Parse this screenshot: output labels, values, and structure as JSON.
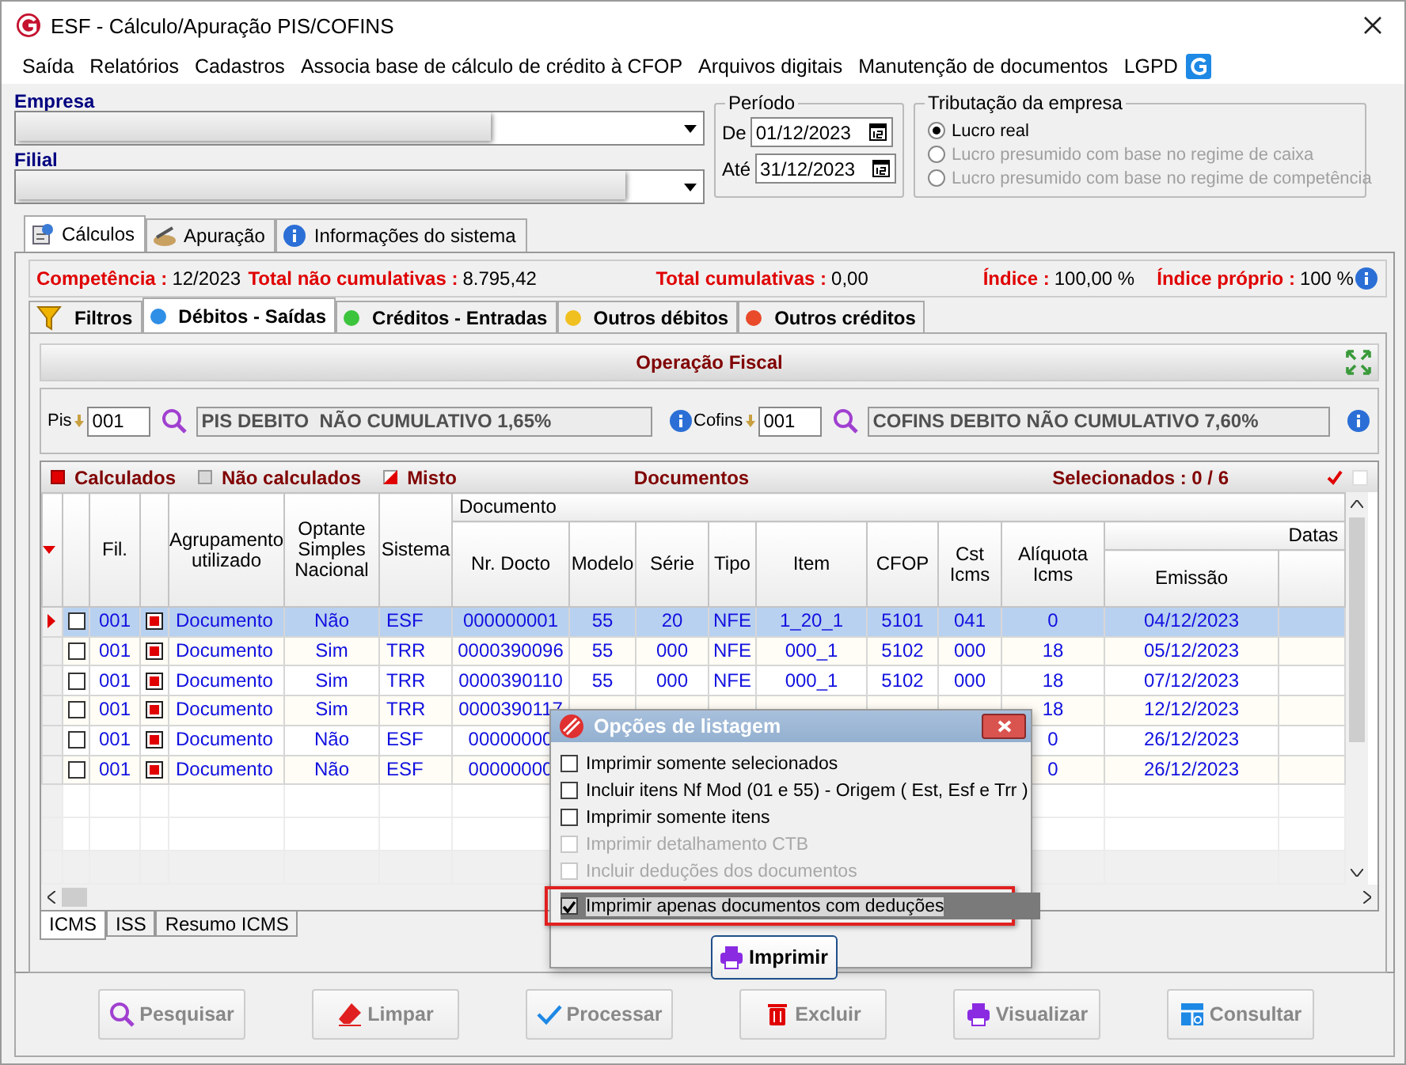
{
  "window": {
    "title": "ESF - Cálculo/Apuração PIS/COFINS"
  },
  "menu": [
    "Saída",
    "Relatórios",
    "Cadastros",
    "Associa base de cálculo de crédito à CFOP",
    "Arquivos digitais",
    "Manutenção de documentos",
    "LGPD"
  ],
  "empresa": {
    "label": "Empresa"
  },
  "filial": {
    "label": "Filial"
  },
  "periodo": {
    "title": "Período",
    "from_label": "De",
    "from": "01/12/2023",
    "to_label": "Até",
    "to": "31/12/2023"
  },
  "tributacao": {
    "title": "Tributação da empresa",
    "options": [
      {
        "label": "Lucro real",
        "selected": true,
        "disabled": false
      },
      {
        "label": "Lucro presumido com base no regime de caixa",
        "selected": false,
        "disabled": true
      },
      {
        "label": "Lucro presumido com base no regime de competência",
        "selected": false,
        "disabled": true
      }
    ]
  },
  "main_tabs": [
    {
      "label": "Cálculos",
      "kind": "calc",
      "selected": true
    },
    {
      "label": "Apuração",
      "kind": "apur",
      "selected": false
    },
    {
      "label": "Informações do sistema",
      "kind": "info",
      "selected": false
    }
  ],
  "summary": [
    {
      "label": "Competência :",
      "value": "12/2023"
    },
    {
      "label": "Total não cumulativas :",
      "value": "8.795,42"
    },
    {
      "label": "Total cumulativas :",
      "value": "0,00"
    },
    {
      "label": "Índice :",
      "value": "100,00 %"
    },
    {
      "label": "Índice próprio :",
      "value": "100 %"
    }
  ],
  "sub_tabs": [
    {
      "label": "Filtros",
      "kind": "filter",
      "selected": false
    },
    {
      "label": "Débitos - Saídas",
      "kind": "dot",
      "color": "#2f8fe6",
      "selected": true
    },
    {
      "label": "Créditos - Entradas",
      "kind": "dot",
      "color": "#3cc43c",
      "selected": false
    },
    {
      "label": "Outros débitos",
      "kind": "dot",
      "color": "#f0c020",
      "selected": false
    },
    {
      "label": "Outros créditos",
      "kind": "dot",
      "color": "#e84a2a",
      "selected": false
    }
  ],
  "operacao": {
    "title": "Operação Fiscal",
    "pis_label": "Pis",
    "pis_code": "001",
    "pis_desc": "PIS DEBITO  NÃO CUMULATIVO 1,65%",
    "cofins_label": "Cofins",
    "cofins_code": "001",
    "cofins_desc": "COFINS DEBITO NÃO CUMULATIVO 7,60%"
  },
  "legend": [
    {
      "label": "Calculados",
      "kind": "full"
    },
    {
      "label": "Não calculados",
      "kind": "empty"
    },
    {
      "label": "Misto",
      "kind": "half"
    }
  ],
  "documents_title": "Documentos",
  "selected_count": "Selecionados : 0 / 6",
  "table": {
    "document_group": "Documento",
    "dates_group": "Datas",
    "columns": [
      "Fil.",
      "Agrupamento utilizado",
      "Optante Simples Nacional",
      "Sistema",
      "Nr. Docto",
      "Modelo",
      "Série",
      "Tipo",
      "Item",
      "CFOP",
      "Cst Icms",
      "Alíquota Icms",
      "Emissão"
    ],
    "rows": [
      {
        "selected": true,
        "checked": false,
        "cells": [
          "001",
          "Documento",
          "Não",
          "ESF",
          "000000001",
          "55",
          "20",
          "NFE",
          "1_20_1",
          "5101",
          "041",
          "0",
          "04/12/2023"
        ]
      },
      {
        "selected": false,
        "checked": false,
        "cells": [
          "001",
          "Documento",
          "Sim",
          "TRR",
          "0000390096",
          "55",
          "000",
          "NFE",
          "000_1",
          "5102",
          "000",
          "18",
          "05/12/2023"
        ]
      },
      {
        "selected": false,
        "checked": false,
        "cells": [
          "001",
          "Documento",
          "Sim",
          "TRR",
          "0000390110",
          "55",
          "000",
          "NFE",
          "000_1",
          "5102",
          "000",
          "18",
          "07/12/2023"
        ]
      },
      {
        "selected": false,
        "checked": false,
        "cells": [
          "001",
          "Documento",
          "Sim",
          "TRR",
          "0000390117",
          null,
          null,
          null,
          null,
          null,
          null,
          "18",
          "12/12/2023"
        ]
      },
      {
        "selected": false,
        "checked": false,
        "cells": [
          "001",
          "Documento",
          "Não",
          "ESF",
          "00000000",
          null,
          null,
          null,
          null,
          null,
          null,
          "0",
          "26/12/2023"
        ]
      },
      {
        "selected": false,
        "checked": false,
        "cells": [
          "001",
          "Documento",
          "Não",
          "ESF",
          "00000000",
          null,
          null,
          null,
          null,
          null,
          null,
          "0",
          "26/12/2023"
        ]
      }
    ]
  },
  "bottom_tabs": [
    {
      "label": "ICMS",
      "selected": true
    },
    {
      "label": "ISS",
      "selected": false
    },
    {
      "label": "Resumo ICMS",
      "selected": false
    }
  ],
  "buttons": [
    {
      "label": "Pesquisar",
      "kind": "search"
    },
    {
      "label": "Limpar",
      "kind": "eraser"
    },
    {
      "label": "Processar",
      "kind": "check"
    },
    {
      "label": "Excluir",
      "kind": "trash"
    },
    {
      "label": "Visualizar",
      "kind": "print"
    },
    {
      "label": "Consultar",
      "kind": "grid"
    }
  ],
  "dialog": {
    "title": "Opções de listagem",
    "options": [
      {
        "label": "Imprimir somente selecionados",
        "checked": false,
        "disabled": false,
        "highlighted": false
      },
      {
        "label": "Incluir itens Nf Mod (01 e 55) - Origem ( Est, Esf e Trr )",
        "checked": false,
        "disabled": false,
        "highlighted": false
      },
      {
        "label": "Imprimir somente itens",
        "checked": false,
        "disabled": false,
        "highlighted": false
      },
      {
        "label": "Imprimir detalhamento CTB",
        "checked": false,
        "disabled": true,
        "highlighted": false
      },
      {
        "label": "Incluir deduções dos documentos",
        "checked": false,
        "disabled": true,
        "highlighted": false
      },
      {
        "label": "Imprimir apenas documentos com deduções",
        "checked": true,
        "disabled": false,
        "highlighted": true
      }
    ],
    "button": "Imprimir"
  }
}
